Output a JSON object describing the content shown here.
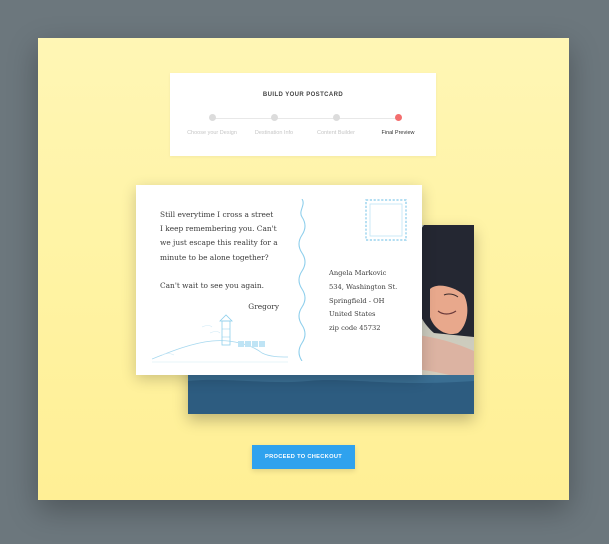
{
  "stepper": {
    "title": "BUILD YOUR POSTCARD",
    "steps": [
      {
        "label": "Choose your Design",
        "state": "complete"
      },
      {
        "label": "Destination Info",
        "state": "complete"
      },
      {
        "label": "Content Builder",
        "state": "complete"
      },
      {
        "label": "Final Preview",
        "state": "active"
      }
    ]
  },
  "postcard": {
    "message_lines_1": [
      "Still everytime I cross a street",
      "I keep remembering you. Can't",
      "we just escape this reality for a",
      "minute to be alone together?"
    ],
    "message_line_2": "Can't wait to see you again.",
    "signature": "Gregory",
    "address": {
      "name": "Angela Markovic",
      "street": "534, Washington St.",
      "city": "Springfield - OH",
      "country": "United States",
      "zip": "zip code 45732"
    }
  },
  "cta": {
    "label": "PROCEED TO CHECKOUT"
  },
  "colors": {
    "background": "#6c777d",
    "panel": "#fff3a2",
    "accent_blue": "#2fa2ee",
    "active_step": "#f36e6e",
    "postcard_line": "#8fcfec"
  },
  "icons": [
    "stamp-icon",
    "lighthouse-illustration"
  ]
}
